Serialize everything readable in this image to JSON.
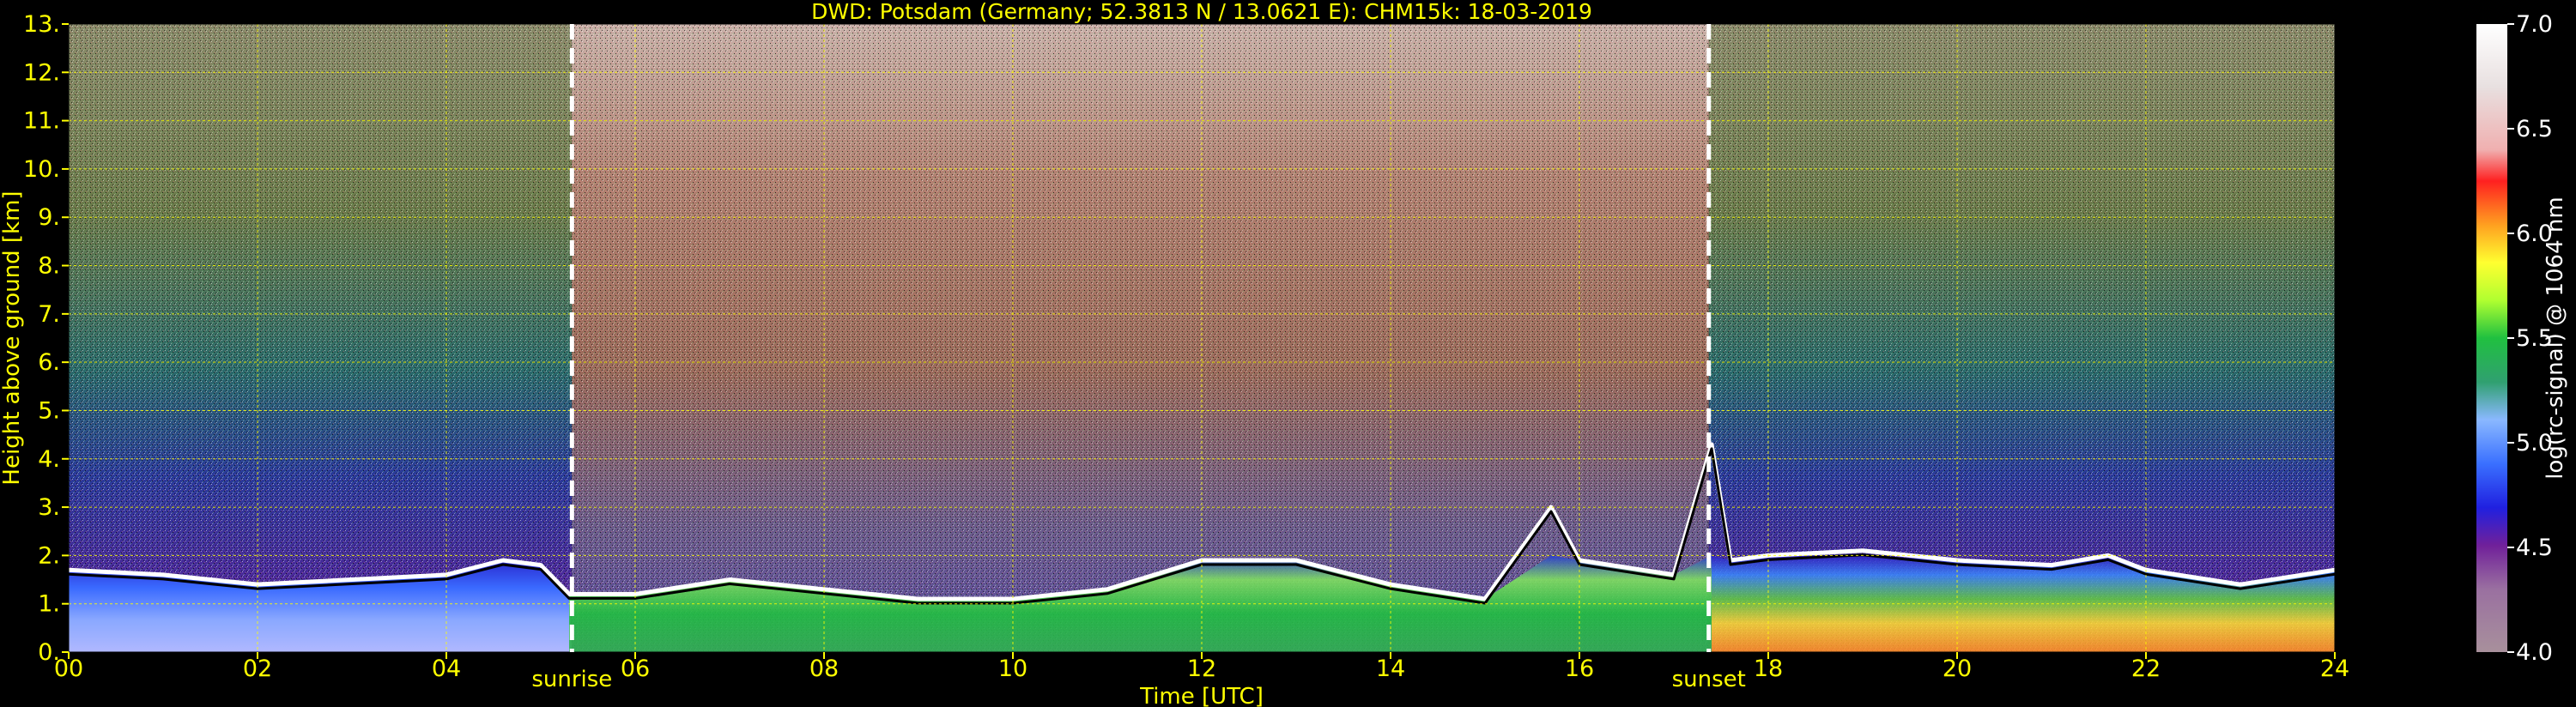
{
  "chart_data": {
    "type": "heatmap",
    "title": "DWD: Potsdam (Germany; 52.3813 N / 13.0621 E):    CHM15k: 18-03-2019",
    "xlabel": "Time [UTC]",
    "ylabel": "Height above ground [km]",
    "xlim": [
      0,
      24
    ],
    "ylim": [
      0,
      13
    ],
    "x_ticks": [
      "00",
      "02",
      "04",
      "06",
      "08",
      "10",
      "12",
      "14",
      "16",
      "18",
      "20",
      "22",
      "24"
    ],
    "y_ticks": [
      "0.",
      "1.",
      "2.",
      "3.",
      "4.",
      "5.",
      "6.",
      "7.",
      "8.",
      "9.",
      "10.",
      "11.",
      "12.",
      "13."
    ],
    "grid": true,
    "annotations": [
      {
        "label": "sunrise",
        "x": 5.33
      },
      {
        "label": "sunset",
        "x": 17.37
      }
    ],
    "colorbar": {
      "label": "log(rc-signal) @ 1064 nm",
      "range": [
        4.0,
        7.0
      ],
      "ticks": [
        "4.0",
        "4.5",
        "5.0",
        "5.5",
        "6.0",
        "6.5",
        "7.0"
      ]
    },
    "boundary_layer_top_km": [
      [
        0,
        1.7
      ],
      [
        1,
        1.6
      ],
      [
        2,
        1.4
      ],
      [
        3,
        1.5
      ],
      [
        4,
        1.6
      ],
      [
        4.6,
        1.9
      ],
      [
        5.0,
        1.8
      ],
      [
        5.3,
        1.2
      ],
      [
        6,
        1.2
      ],
      [
        7,
        1.5
      ],
      [
        8,
        1.3
      ],
      [
        9,
        1.1
      ],
      [
        10,
        1.1
      ],
      [
        11,
        1.3
      ],
      [
        12,
        1.9
      ],
      [
        13,
        1.9
      ],
      [
        14,
        1.4
      ],
      [
        15,
        1.1
      ],
      [
        15.7,
        3.0
      ],
      [
        16,
        1.9
      ],
      [
        17,
        1.6
      ],
      [
        17.4,
        4.3
      ],
      [
        17.6,
        1.9
      ],
      [
        18,
        2.0
      ],
      [
        19,
        2.1
      ],
      [
        20,
        1.9
      ],
      [
        21,
        1.8
      ],
      [
        21.6,
        2.0
      ],
      [
        22,
        1.7
      ],
      [
        23,
        1.4
      ],
      [
        24,
        1.7
      ]
    ],
    "colors": {
      "background": "#000000",
      "text": "#ffff00",
      "grid": "#ffff00",
      "marker_line": "#ffffff"
    }
  }
}
